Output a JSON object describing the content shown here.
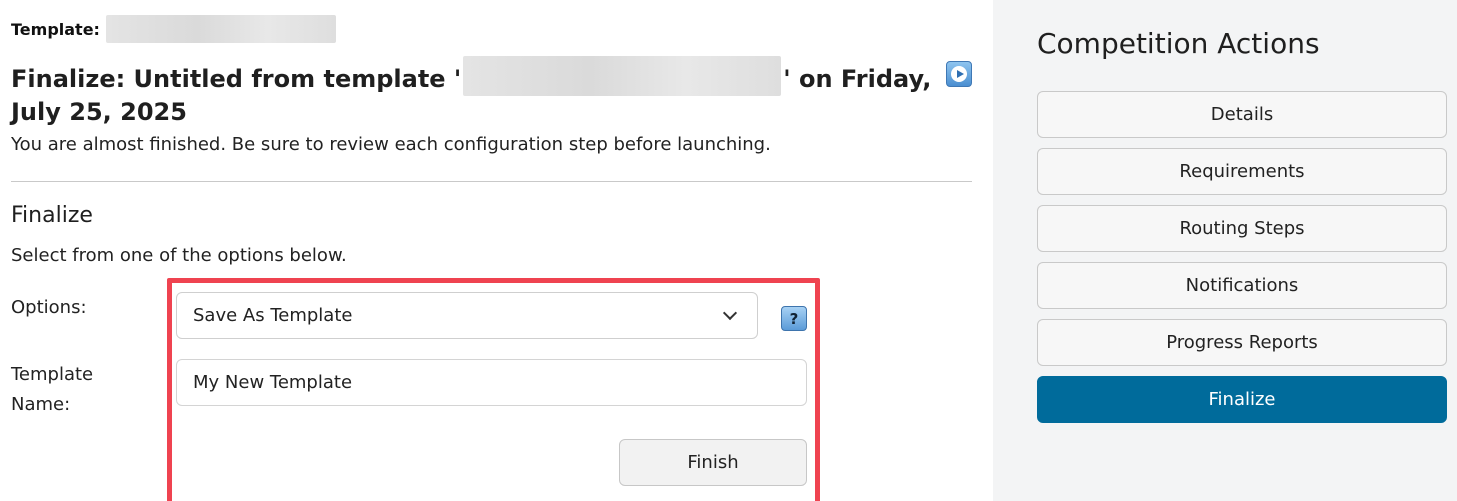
{
  "header": {
    "template_label": "Template:",
    "title_prefix": "Finalize: Untitled from template '",
    "title_suffix": "' on Friday, July 25, 2025",
    "intro_text": "You are almost finished. Be sure to review each configuration step before launching.",
    "video_icon": "play-video-icon"
  },
  "finalize": {
    "section_title": "Finalize",
    "instructions": "Select from one of the options below.",
    "options_label": "Options:",
    "options_selected": "Save As Template",
    "help_label": "?",
    "template_name_label": "Template Name:",
    "template_name_value": "My New Template",
    "finish_label": "Finish",
    "highlight_color": "#ef4350"
  },
  "sidebar": {
    "title": "Competition Actions",
    "actions": [
      {
        "label": "Details"
      },
      {
        "label": "Requirements"
      },
      {
        "label": "Routing Steps"
      },
      {
        "label": "Notifications"
      },
      {
        "label": "Progress Reports"
      },
      {
        "label": "Finalize",
        "active": true
      }
    ],
    "active_color": "#006b9b"
  }
}
